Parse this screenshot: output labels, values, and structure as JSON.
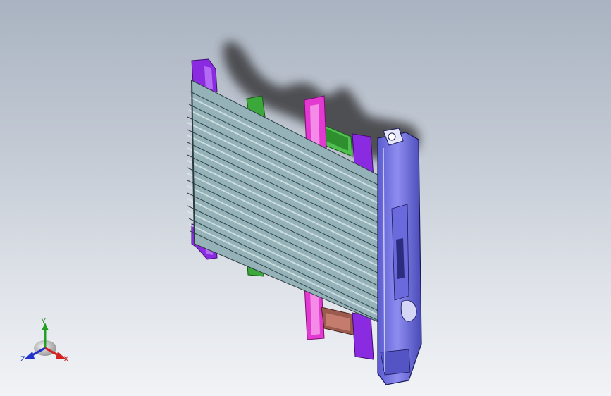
{
  "triad": {
    "x_label": "X",
    "y_label": "Y",
    "z_label": "Z",
    "colors": {
      "x": "#d22222",
      "y": "#22a022",
      "z": "#2233cc"
    }
  },
  "model": {
    "colors": {
      "background_top": "#a9b3c1",
      "background_bottom": "#f1f3f6",
      "slats": "#a8c4c8",
      "crossmember": "#7f7fe6",
      "post_purple": "#8a2be2",
      "post_magenta": "#e23ad0",
      "post_green": "#3ca83c",
      "post_brown": "#9a5a4e",
      "shadow": "#3a3a3e"
    }
  }
}
